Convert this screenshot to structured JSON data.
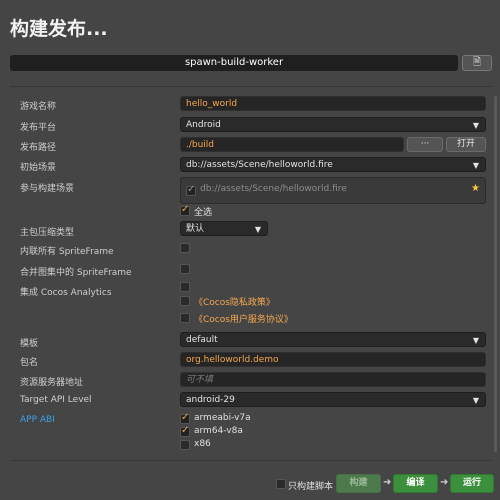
{
  "header": {
    "title": "构建发布..."
  },
  "worker": {
    "label": "spawn-build-worker",
    "doc_icon": "document-icon"
  },
  "fields": {
    "game_name": {
      "label": "游戏名称",
      "value": "hello_world"
    },
    "platform": {
      "label": "发布平台",
      "value": "Android"
    },
    "build_path": {
      "label": "发布路径",
      "value": "./build",
      "browse": "···",
      "open": "打开"
    },
    "start_scene": {
      "label": "初始场景",
      "value": "db://assets/Scene/helloworld.fire"
    },
    "included_scenes": {
      "label": "参与构建场景",
      "scene": "db://assets/Scene/helloworld.fire",
      "select_all": "全选"
    },
    "compression": {
      "label": "主包压缩类型",
      "value": "默认"
    },
    "inline_sf": {
      "label": "内联所有 SpriteFrame"
    },
    "merge_sf": {
      "label": "合并图集中的 SpriteFrame"
    },
    "analytics": {
      "label": "集成 Cocos Analytics",
      "privacy": "《Cocos隐私政策》",
      "service": "《Cocos用户服务协议》"
    },
    "template": {
      "label": "模板",
      "value": "default"
    },
    "package": {
      "label": "包名",
      "value": "org.helloworld.demo"
    },
    "resource_server": {
      "label": "资源服务器地址",
      "placeholder": "可不填"
    },
    "target_api": {
      "label": "Target API Level",
      "value": "android-29"
    },
    "app_abi": {
      "label": "APP ABI",
      "options": [
        "armeabi-v7a",
        "arm64-v8a",
        "x86"
      ],
      "checked": [
        true,
        true,
        false
      ]
    }
  },
  "footer": {
    "build_script_only": "只构建脚本",
    "build": "构建",
    "compile": "编译",
    "run": "运行",
    "arrow": "➜"
  },
  "colors": {
    "accent": "#f5a74e",
    "link": "#3b9fe8",
    "green": "#3c8f3c"
  }
}
